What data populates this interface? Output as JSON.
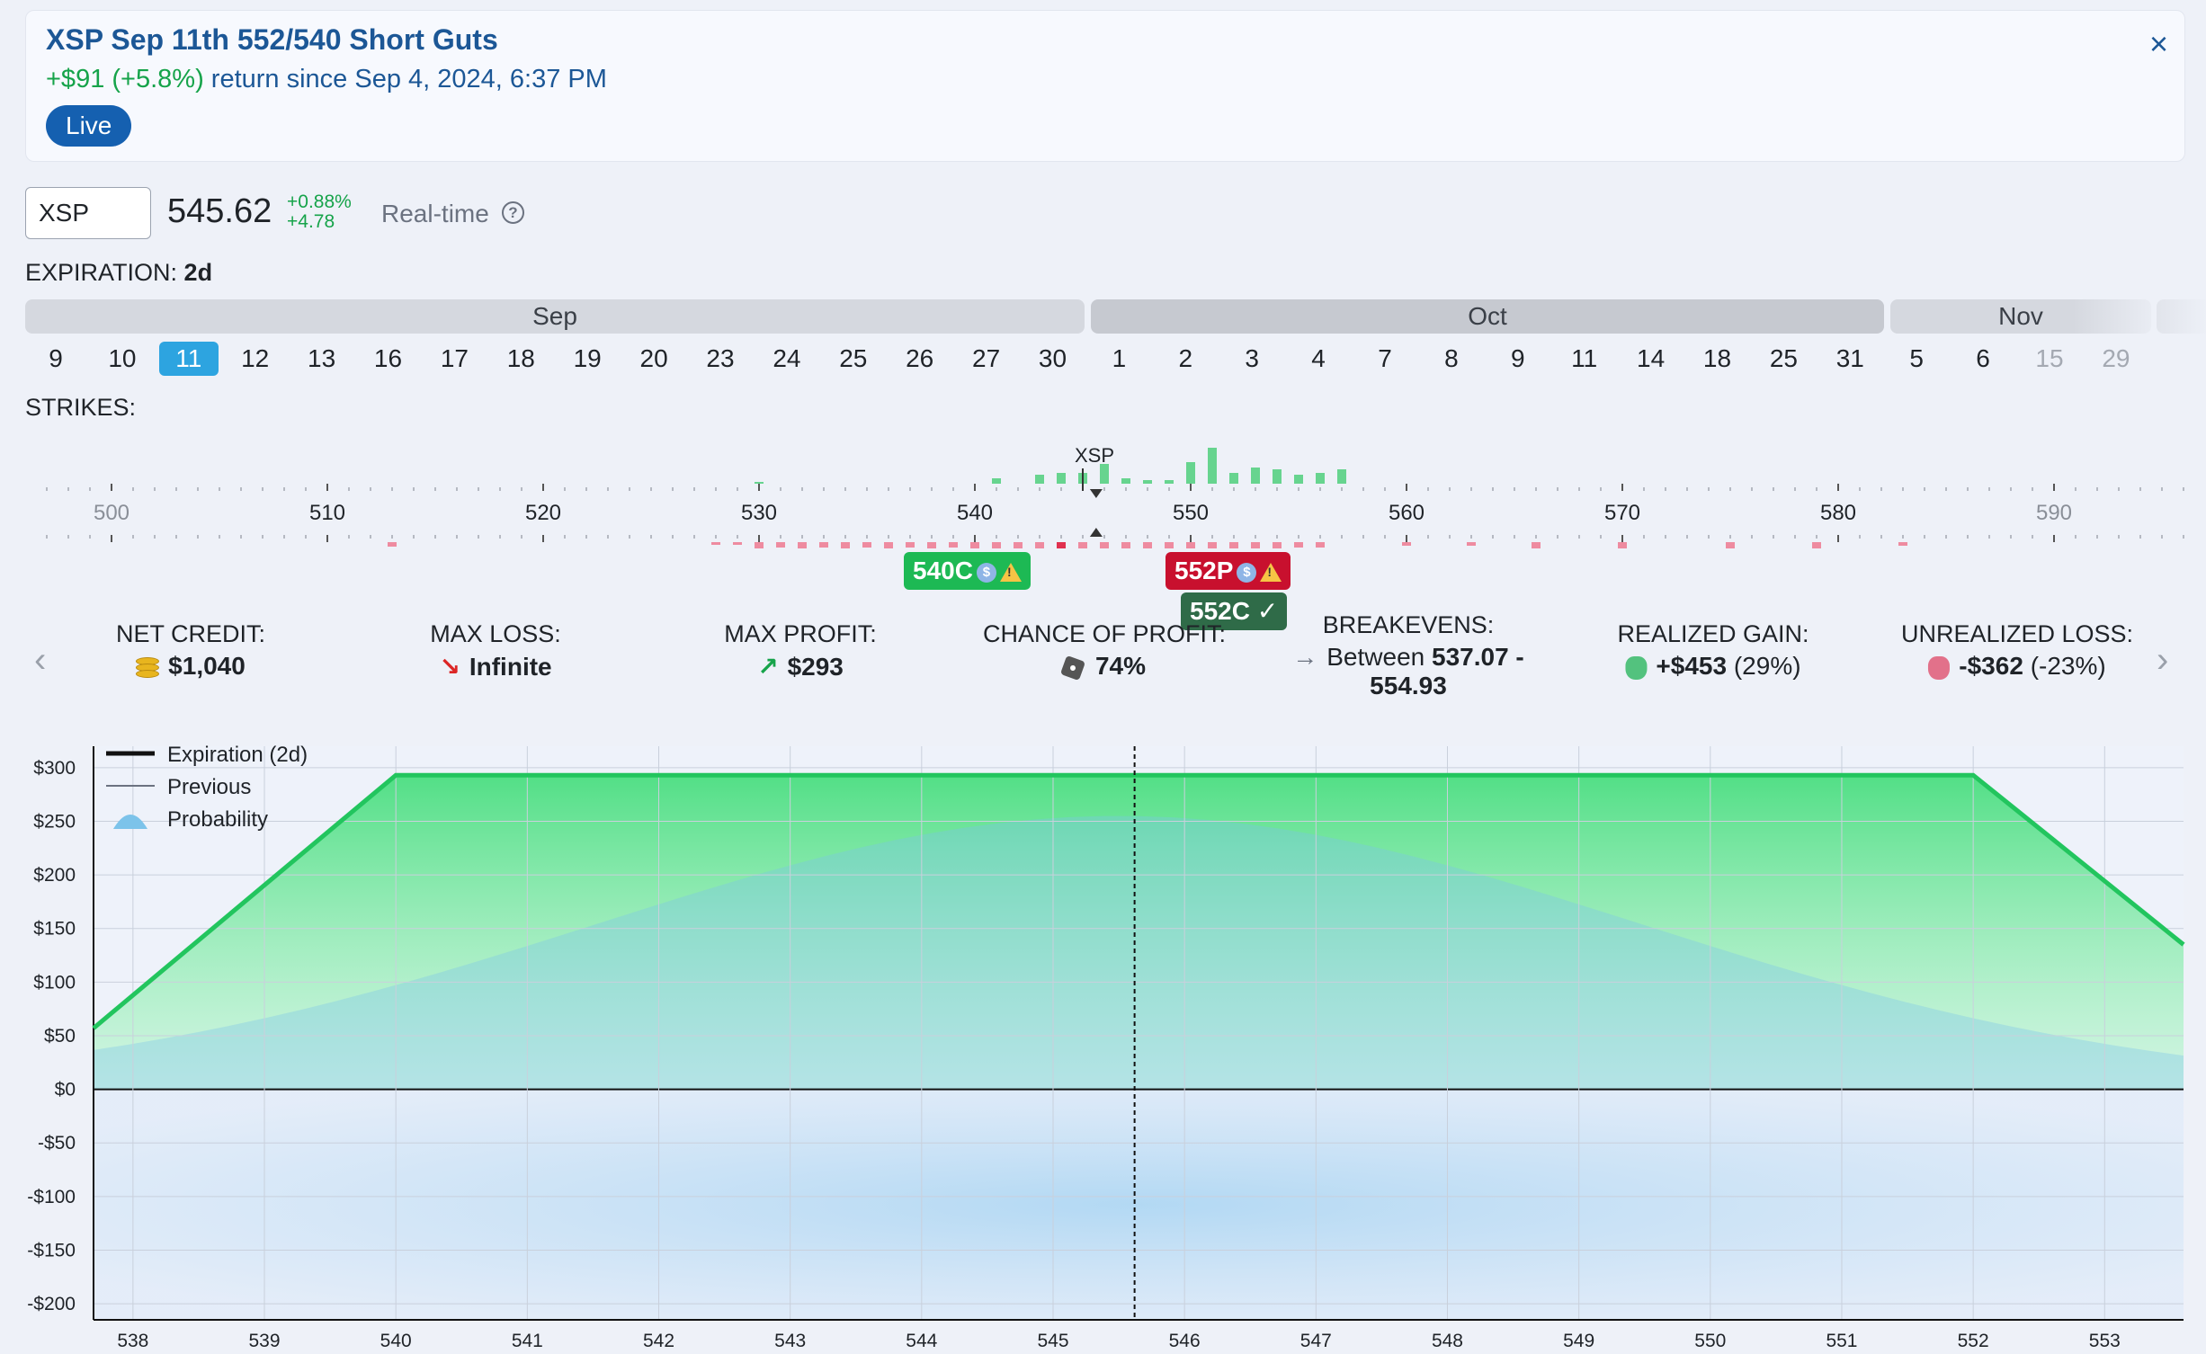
{
  "header": {
    "title": "XSP Sep 11th 552/540 Short Guts",
    "return_amount": "+$91 (+5.8%)",
    "return_text": " return since Sep 4, 2024, 6:37 PM",
    "live_label": "Live",
    "close_symbol": "×"
  },
  "quote": {
    "symbol": "XSP",
    "price": "545.62",
    "change_pct": "+0.88%",
    "change_abs": "+4.78",
    "realtime_label": "Real-time",
    "help_symbol": "?"
  },
  "expiration": {
    "label": "EXPIRATION:",
    "value": "2d"
  },
  "months": [
    {
      "name": "Sep"
    },
    {
      "name": "Oct"
    },
    {
      "name": "Nov"
    }
  ],
  "dates": [
    {
      "label": "9",
      "state": "normal"
    },
    {
      "label": "10",
      "state": "normal"
    },
    {
      "label": "11",
      "state": "selected"
    },
    {
      "label": "12",
      "state": "normal"
    },
    {
      "label": "13",
      "state": "normal"
    },
    {
      "label": "16",
      "state": "normal"
    },
    {
      "label": "17",
      "state": "normal"
    },
    {
      "label": "18",
      "state": "normal"
    },
    {
      "label": "19",
      "state": "normal"
    },
    {
      "label": "20",
      "state": "normal"
    },
    {
      "label": "23",
      "state": "normal"
    },
    {
      "label": "24",
      "state": "normal"
    },
    {
      "label": "25",
      "state": "normal"
    },
    {
      "label": "26",
      "state": "normal"
    },
    {
      "label": "27",
      "state": "normal"
    },
    {
      "label": "30",
      "state": "normal"
    },
    {
      "label": "1",
      "state": "normal"
    },
    {
      "label": "2",
      "state": "normal"
    },
    {
      "label": "3",
      "state": "normal"
    },
    {
      "label": "4",
      "state": "normal"
    },
    {
      "label": "7",
      "state": "normal"
    },
    {
      "label": "8",
      "state": "normal"
    },
    {
      "label": "9",
      "state": "normal"
    },
    {
      "label": "11",
      "state": "normal"
    },
    {
      "label": "14",
      "state": "normal"
    },
    {
      "label": "18",
      "state": "normal"
    },
    {
      "label": "25",
      "state": "normal"
    },
    {
      "label": "31",
      "state": "normal"
    },
    {
      "label": "5",
      "state": "normal"
    },
    {
      "label": "6",
      "state": "normal"
    },
    {
      "label": "15",
      "state": "dim"
    },
    {
      "label": "29",
      "state": "dim"
    }
  ],
  "strikes": {
    "label": "STRIKES:",
    "ticker_marker": "XSP",
    "axis_labels": [
      "500",
      "510",
      "520",
      "530",
      "540",
      "550",
      "560",
      "570",
      "580",
      "590"
    ],
    "tags": [
      {
        "label": "540C",
        "color": "#1db954"
      },
      {
        "label": "552P",
        "color": "#c8102e"
      },
      {
        "label": "552C",
        "color": "#2f6b48"
      }
    ],
    "tag_dollar": "$",
    "tag_warn": "!",
    "tag_check": "✓"
  },
  "stats": [
    {
      "label": "NET CREDIT:",
      "value": "$1,040",
      "icon": "coins-icon"
    },
    {
      "label": "MAX LOSS:",
      "value": "Infinite",
      "icon": "arrow-down-right-icon",
      "arrow": "↘",
      "arrow_color": "#dc2626"
    },
    {
      "label": "MAX PROFIT:",
      "value": "$293",
      "icon": "arrow-up-right-icon",
      "arrow": "↗",
      "arrow_color": "#16a34a"
    },
    {
      "label": "CHANCE OF PROFIT:",
      "value": "74%",
      "icon": "dice-icon"
    },
    {
      "label": "BREAKEVENS:",
      "value_prefix": "Between ",
      "value": "537.07 -",
      "value2": "554.93",
      "icon": "arrow-right-icon",
      "arrow": "→"
    },
    {
      "label": "REALIZED GAIN:",
      "value": "+$453",
      "pct": "(29%)",
      "icon": "money-bag-green-icon"
    },
    {
      "label": "UNREALIZED LOSS:",
      "value": "-$362",
      "pct": "(-23%)",
      "icon": "money-bag-red-icon"
    }
  ],
  "nav": {
    "prev": "‹",
    "next": "›"
  },
  "chart_data": {
    "type": "area",
    "x": [
      537.7,
      540,
      552,
      553.6
    ],
    "y": [
      57,
      293,
      293,
      135
    ],
    "xlim": [
      537.7,
      553.6
    ],
    "ylim": [
      -215,
      320
    ],
    "x_ticks": [
      "538",
      "539",
      "540",
      "541",
      "542",
      "543",
      "544",
      "545",
      "546",
      "547",
      "548",
      "549",
      "550",
      "551",
      "552",
      "553"
    ],
    "y_ticks": [
      "$300",
      "$250",
      "$200",
      "$150",
      "$100",
      "$50",
      "$0",
      "-$50",
      "-$100",
      "-$150",
      "-$200"
    ],
    "current_price": 545.62,
    "legend": [
      {
        "name": "Expiration (2d)"
      },
      {
        "name": "Previous"
      },
      {
        "name": "Probability"
      }
    ],
    "colors": {
      "profit_line": "#22c55e",
      "probability": "#7cc3ea"
    }
  }
}
